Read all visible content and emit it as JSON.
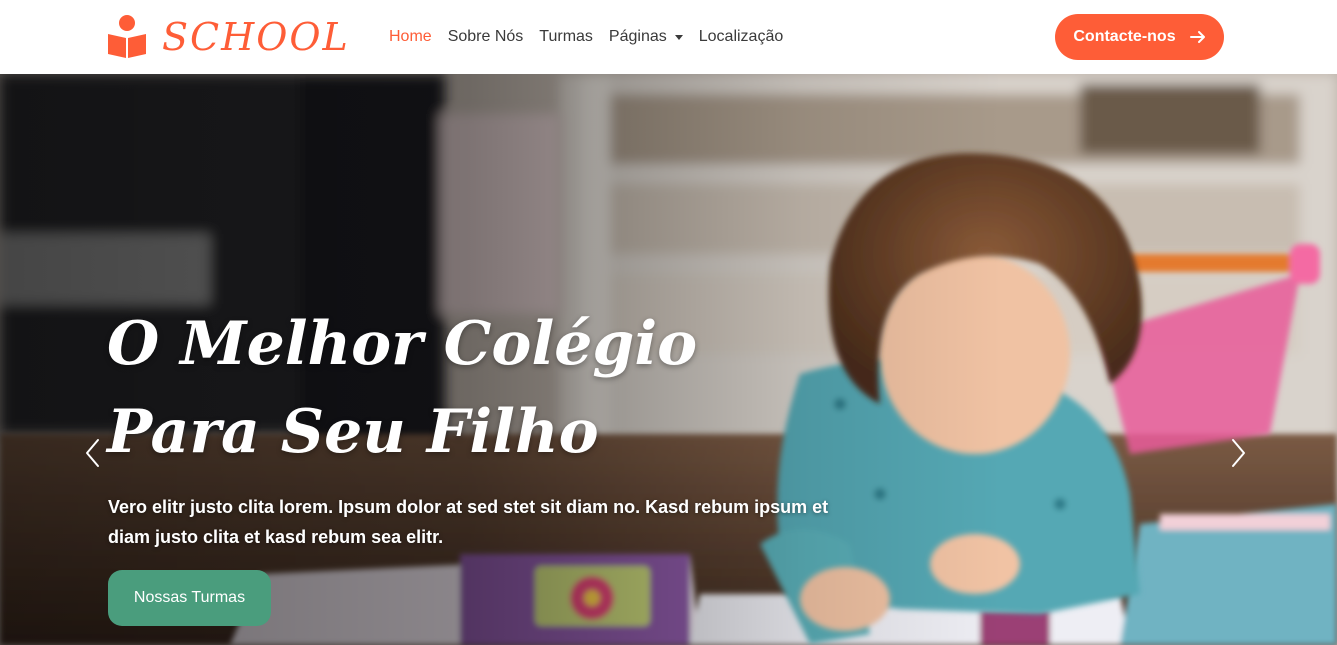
{
  "brand": {
    "name": "SCHOOL",
    "icon": "book-reader-icon"
  },
  "nav": {
    "items": [
      {
        "label": "Home",
        "active": true
      },
      {
        "label": "Sobre Nós",
        "active": false
      },
      {
        "label": "Turmas",
        "active": false
      },
      {
        "label": "Páginas",
        "active": false,
        "dropdown": true
      },
      {
        "label": "Localização",
        "active": false
      }
    ]
  },
  "contact_button": {
    "label": "Contacte-nos",
    "icon": "arrow-right-icon"
  },
  "hero": {
    "title": "O Melhor Colégio Para Seu Filho",
    "text": "Vero elitr justo clita lorem. Ipsum dolor at sed stet sit diam no. Kasd rebum ipsum et diam justo clita et kasd rebum sea elitr.",
    "button_label": "Nossas Turmas",
    "prev_icon": "chevron-left-icon",
    "next_icon": "chevron-right-icon"
  },
  "colors": {
    "accent": "#FE5D37",
    "secondary": "#4A9D7D",
    "nav_text": "#3a3a3a",
    "white": "#FFFFFF"
  }
}
